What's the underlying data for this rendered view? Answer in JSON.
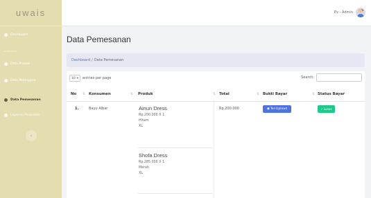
{
  "brand": "uwais",
  "sidebar": {
    "heading": "Interface",
    "items": [
      {
        "label": "Dashboard",
        "icon": "dashboard-icon"
      },
      {
        "label": "Data Produk",
        "icon": "box-icon"
      },
      {
        "label": "Data Pelanggan",
        "icon": "users-icon"
      },
      {
        "label": "Data Pemesanan",
        "icon": "cart-icon",
        "active": true
      },
      {
        "label": "Laporan Penjualan",
        "icon": "report-icon"
      }
    ],
    "toggle_icon": "chevron-left-icon"
  },
  "topbar": {
    "user_name": "Ev - Admin"
  },
  "page_title": "Data Pemesanan",
  "breadcrumb": {
    "home": "Dashboard",
    "separator": "/",
    "current": "Data Pemesanan"
  },
  "table_controls": {
    "length_value": "10",
    "length_suffix": "entries per page",
    "search_label": "Search:",
    "search_placeholder": ""
  },
  "table": {
    "columns": [
      "No",
      "Konsumen",
      "Produk",
      "Total",
      "Bukti Bayar",
      "Status Bayar"
    ],
    "rows": [
      {
        "no": "1.",
        "konsumen": "Bayu Albar",
        "produk": [
          {
            "name": "Ainun Dress",
            "price_qty": "Rp.200.000 X 1",
            "color": "Hitam",
            "size": "XL"
          },
          {
            "name": "Shofa Dress",
            "price_qty": "Rp.285.000 X 1",
            "color": "Merah",
            "size": "XL"
          }
        ],
        "total": "Rp.200.000",
        "bukti_bayar": "Ter-Upload",
        "status_bayar": "Lunas"
      }
    ]
  },
  "colors": {
    "sidebar": "#e4ddb0",
    "primary": "#4e73df",
    "success": "#1cc88a"
  }
}
